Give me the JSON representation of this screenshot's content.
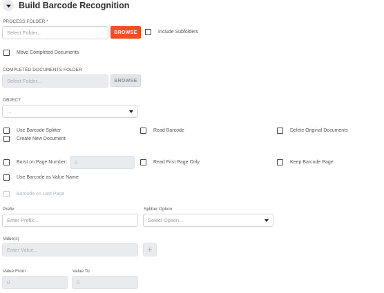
{
  "header": {
    "title": "Build Barcode Recognition"
  },
  "process_folder": {
    "label": "PROCESS FOLDER *",
    "placeholder": "Select Folder...",
    "browse_label": "BROWSE",
    "include_subfolders_label": "Include Subfolders"
  },
  "move_completed_label": "Move Completed Documents",
  "completed_folder": {
    "label": "COMPLETED DOCUMENTS FOLDER",
    "placeholder": "Select Folder...",
    "browse_label": "BROWSE"
  },
  "object": {
    "label": "OBJECT",
    "value": "..."
  },
  "options": {
    "use_barcode_splitter": "Use Barcode Splitter",
    "read_barcode": "Read Barcode",
    "delete_original": "Delete Original Documents",
    "create_new_document": "Create New Document",
    "burst_on_page_number": "Burst on Page Number:",
    "burst_value": "0",
    "read_first_page_only": "Read First Page Only",
    "keep_barcode_page": "Keep Barcode Page",
    "use_barcode_as_value_name": "Use Barcode as Value Name",
    "barcode_on_last_page": "Barcode on Last Page"
  },
  "prefix": {
    "label": "Prefix",
    "placeholder": "Enter Prefix..."
  },
  "splitter_option": {
    "label": "Splitter Option",
    "value": "Select Option..."
  },
  "values": {
    "label": "Value(s)",
    "placeholder": "Enter Value...",
    "add_symbol": "+"
  },
  "value_from": {
    "label": "Value From",
    "value": "0"
  },
  "value_to": {
    "label": "Value To",
    "value": "0"
  }
}
